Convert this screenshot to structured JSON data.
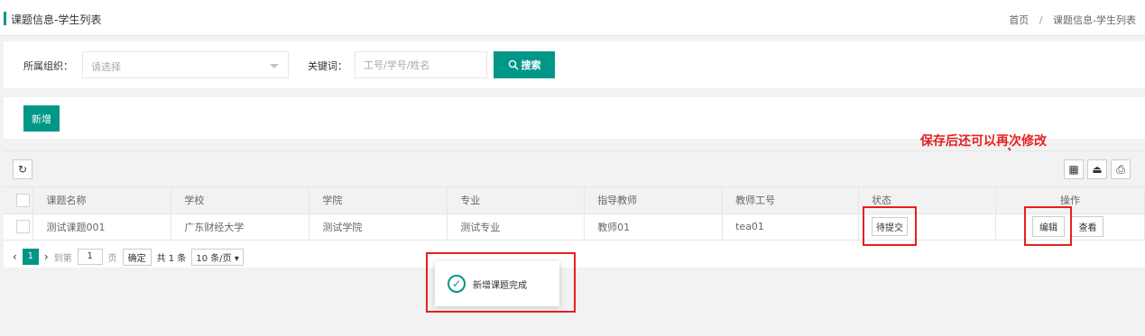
{
  "header": {
    "title": "课题信息-学生列表",
    "breadcrumb": [
      "首页",
      "课题信息-学生列表"
    ],
    "separator": "/"
  },
  "filter": {
    "org_label": "所属组织：",
    "org_placeholder": "请选择",
    "keyword_label": "关键词：",
    "keyword_placeholder": "工号/学号/姓名",
    "search_label": "搜索"
  },
  "toolbar": {
    "add_label": "新增"
  },
  "table": {
    "columns": [
      "课题名称",
      "学校",
      "学院",
      "专业",
      "指导教师",
      "教师工号",
      "状态",
      "操作"
    ],
    "rows": [
      {
        "topic": "测试课题001",
        "school": "广东财经大学",
        "college": "测试学院",
        "major": "测试专业",
        "teacher": "教师01",
        "teacher_id": "tea01",
        "status": "待提交",
        "edit": "编辑",
        "view": "查看"
      }
    ]
  },
  "pagination": {
    "current": "1",
    "goto_label": "到第",
    "page_input": "1",
    "page_unit": "页",
    "confirm": "确定",
    "total": "共 1 条",
    "page_size": "10 条/页"
  },
  "annotation": {
    "text": "保存后还可以再次修改",
    "color": "#e62020"
  },
  "toast": {
    "message": "新增课题完成"
  },
  "colors": {
    "accent": "#009688"
  }
}
